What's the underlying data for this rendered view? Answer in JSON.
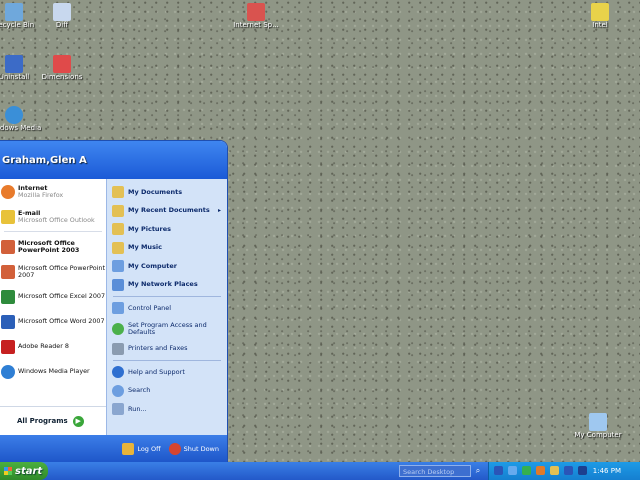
{
  "desktop": {
    "icons": [
      {
        "label": "Recycle Bin",
        "color": "#6fa8dc",
        "icon": "recycle-bin-icon"
      },
      {
        "label": "Diff",
        "color": "#c8d8ee",
        "icon": "document-icon"
      },
      {
        "label": "Internet Sp...",
        "color": "#d9534f",
        "icon": "document-icon"
      },
      {
        "label": "Intel",
        "color": "#e8d24a",
        "icon": "folder-icon"
      },
      {
        "label": "Uninstall",
        "color": "#3c6bc7",
        "icon": "computer-icon"
      },
      {
        "label": "Dimensions",
        "color": "#e04a4a",
        "icon": "pdf-icon"
      },
      {
        "label": "Windows Media",
        "color": "#3a8fd8",
        "icon": "media-icon"
      },
      {
        "label": "My Computer",
        "color": "#9fc8f0",
        "icon": "computer-icon"
      }
    ]
  },
  "start_menu": {
    "user": "Graham,Glen A",
    "pinned": [
      {
        "title": "Internet",
        "subtitle": "Mozilla Firefox",
        "color": "#e87b2c",
        "icon": "firefox-icon"
      },
      {
        "title": "E-mail",
        "subtitle": "Microsoft Office Outlook",
        "color": "#e8c23a",
        "icon": "outlook-icon"
      }
    ],
    "recent": [
      {
        "title": "Microsoft Office PowerPoint 2003",
        "bold": true,
        "color": "#d2603a",
        "icon": "powerpoint-icon"
      },
      {
        "title": "Microsoft Office PowerPoint 2007",
        "color": "#d2603a",
        "icon": "powerpoint-icon"
      },
      {
        "title": "Microsoft Office Excel 2007",
        "color": "#2e8b3c",
        "icon": "excel-icon"
      },
      {
        "title": "Microsoft Office Word 2007",
        "color": "#2b5fb8",
        "icon": "word-icon"
      },
      {
        "title": "Adobe Reader 8",
        "color": "#c62020",
        "icon": "adobe-reader-icon"
      },
      {
        "title": "Windows Media Player",
        "color": "#2f7fd4",
        "icon": "media-player-icon"
      }
    ],
    "all_programs": "All Programs",
    "places": [
      {
        "title": "My Documents",
        "color": "#e3c054",
        "icon": "my-documents-icon"
      },
      {
        "title": "My Recent Documents",
        "color": "#e3c054",
        "icon": "recent-documents-icon",
        "more": "▸"
      },
      {
        "title": "My Pictures",
        "color": "#e3c054",
        "icon": "my-pictures-icon"
      },
      {
        "title": "My Music",
        "color": "#e3c054",
        "icon": "my-music-icon"
      },
      {
        "title": "My Computer",
        "color": "#6d9ee0",
        "icon": "my-computer-icon"
      },
      {
        "title": "My Network Places",
        "color": "#5a8ed8",
        "icon": "network-places-icon"
      }
    ],
    "settings": [
      {
        "title": "Control Panel",
        "color": "#6d9ee0",
        "icon": "control-panel-icon"
      },
      {
        "title": "Set Program Access and Defaults",
        "color": "#4bb04b",
        "icon": "program-access-icon"
      },
      {
        "title": "Printers and Faxes",
        "color": "#8a9bb0",
        "icon": "printer-icon"
      }
    ],
    "help": [
      {
        "title": "Help and Support",
        "color": "#2f6fd0",
        "icon": "help-icon"
      },
      {
        "title": "Search",
        "color": "#6d9ee0",
        "icon": "search-icon"
      },
      {
        "title": "Run...",
        "color": "#8aa6cf",
        "icon": "run-icon"
      }
    ],
    "log_off": "Log Off",
    "shut_down": "Shut Down"
  },
  "taskbar": {
    "start_label": "start",
    "search_placeholder": "Search Desktop",
    "clock": "1:46 PM",
    "tray_icons": [
      {
        "color": "#2a55b8",
        "icon": "network-icon"
      },
      {
        "color": "#66aaee",
        "icon": "bluetooth-icon"
      },
      {
        "color": "#35b050",
        "icon": "security-icon"
      },
      {
        "color": "#e07a2a",
        "icon": "update-icon"
      },
      {
        "color": "#e3c054",
        "icon": "volume-icon"
      },
      {
        "color": "#2a55b8",
        "icon": "info-icon"
      },
      {
        "color": "#1d3f8f",
        "icon": "language-icon"
      }
    ]
  }
}
